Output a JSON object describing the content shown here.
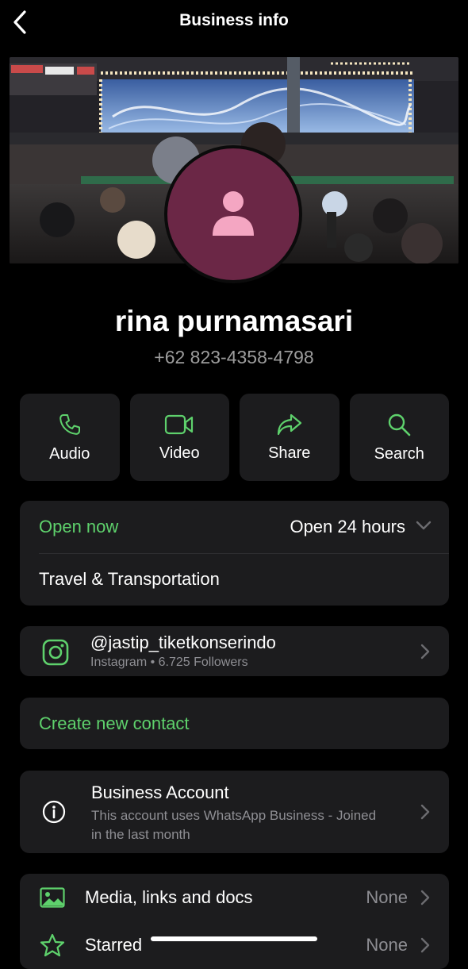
{
  "header": {
    "title": "Business info"
  },
  "profile": {
    "name": "rina purnamasari",
    "phone": "+62 823-4358-4798"
  },
  "actions": [
    {
      "label": "Audio",
      "icon": "phone-icon"
    },
    {
      "label": "Video",
      "icon": "video-icon"
    },
    {
      "label": "Share",
      "icon": "share-icon"
    },
    {
      "label": "Search",
      "icon": "search-icon"
    }
  ],
  "hours": {
    "status": "Open now",
    "schedule": "Open 24 hours"
  },
  "category": "Travel & Transportation",
  "instagram": {
    "handle": "@jastip_tiketkonserindo",
    "subtitle": "Instagram • 6.725 Followers"
  },
  "contact": {
    "create_label": "Create new contact"
  },
  "business_account": {
    "title": "Business Account",
    "description": "This account uses WhatsApp Business - Joined in the last month"
  },
  "media": [
    {
      "label": "Media, links and docs",
      "value": "None",
      "icon": "image-icon"
    },
    {
      "label": "Starred",
      "value": "None",
      "icon": "star-icon"
    }
  ],
  "colors": {
    "accent": "#5ed16c",
    "card": "#1c1c1e",
    "avatar": "#6b2746",
    "avatar_icon": "#f4a6c2",
    "background": "#000000"
  }
}
